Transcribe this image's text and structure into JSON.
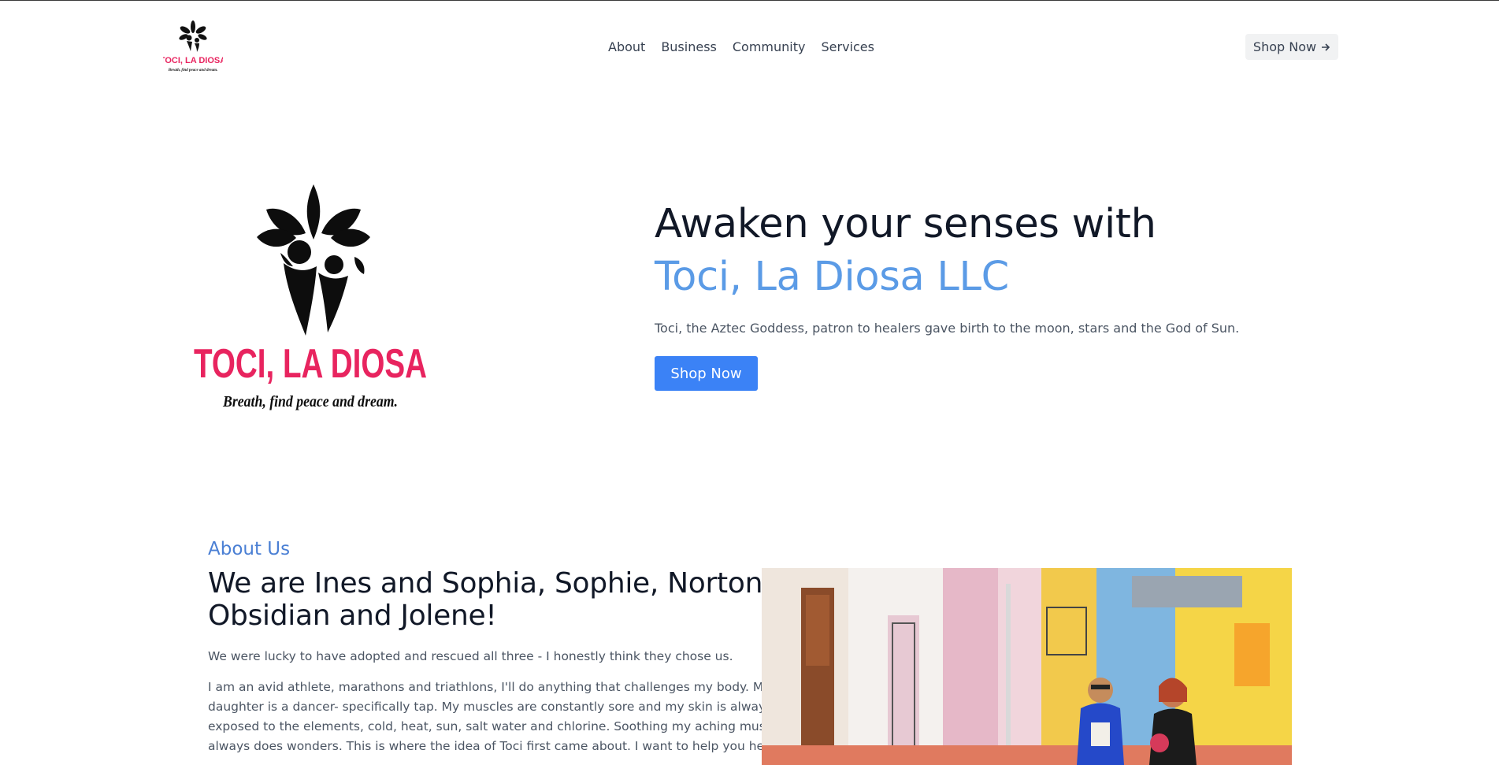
{
  "brand": {
    "name": "TOCI, LA DIOSA",
    "tagline": "Breath, find peace and dream."
  },
  "nav": {
    "items": [
      {
        "label": "About"
      },
      {
        "label": "Business"
      },
      {
        "label": "Community"
      },
      {
        "label": "Services"
      }
    ]
  },
  "header": {
    "cta_label": "Shop Now",
    "cta_icon": "arrow-right-icon"
  },
  "hero": {
    "title_line1": "Awaken your senses with",
    "title_line2": "Toci, La Diosa LLC",
    "description": "Toci, the Aztec Goddess, patron to healers gave birth to the moon, stars and the God of Sun.",
    "button_label": "Shop Now"
  },
  "about": {
    "eyebrow": "About Us",
    "title_line1": "We are Ines and Sophia, Sophie, Norton,",
    "title_line2": "Obsidian and Jolene!",
    "paragraph1": "We were lucky to have adopted and rescued all three - I honestly think they chose us.",
    "paragraph2_lines": [
      "I am an avid athlete, marathons and triathlons, I'll do anything that challenges my body. My",
      "daughter is a dancer- specifically tap. My muscles are constantly sore and my skin is always",
      "exposed to the elements, cold, heat, sun, salt water and chlorine. Soothing my aching muscles",
      "always does wonders. This is where the idea of Toci first came about. I want to help you heal"
    ]
  },
  "colors": {
    "accent": "#5b9be6",
    "button": "#3b82f6",
    "brand_pink": "#e8245f"
  }
}
